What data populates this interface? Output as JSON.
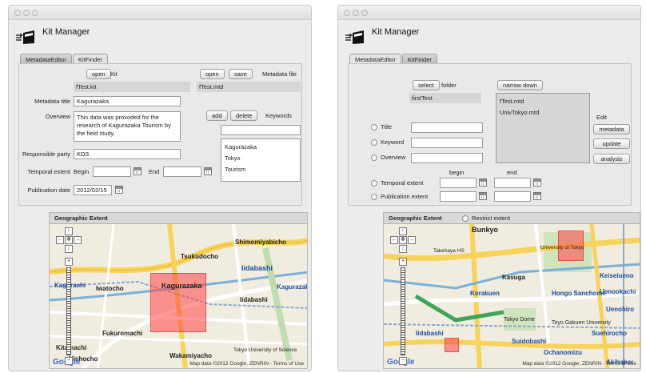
{
  "app_title": "Kit Manager",
  "tabs": {
    "metadata_editor": "MetadataEditor",
    "kit_finder": "KitFinder"
  },
  "editor": {
    "open_kit_label": "open",
    "kit_label": "Kit",
    "kit_file": "fTest.kit",
    "open_meta_label": "open",
    "save_label": "save",
    "metadata_file_label": "Metadata file",
    "metadata_file": "fTest.mtd",
    "metadata_title_label": "Metadata title",
    "metadata_title": "Kagurazaka",
    "overview_label": "Overview",
    "overview": "This data was provoded for the research of Kagurazaka Tourism by the field study.",
    "add_label": "add",
    "delete_label": "delete",
    "keywords_label": "Keywords",
    "keywords_input": "",
    "keywords": [
      "Kagurazaka",
      "Tokyo",
      "Tourism"
    ],
    "responsible_party_label": "Responsible party",
    "responsible_party": "KDS",
    "temporal_extent_label": "Temporal extent",
    "begin_label": "Begin",
    "end_label": "End",
    "begin_value": "",
    "end_value": "",
    "publication_date_label": "Publication date",
    "publication_date": "2012/02/15"
  },
  "finder": {
    "select_label": "select",
    "folder_label": "folder",
    "folder_value": "firstTest",
    "narrow_down_label": "narrow down",
    "results": [
      "fTest.mtd",
      "UnivTokyo.mtd"
    ],
    "title_label": "Title",
    "keyword_label": "Keyword",
    "overview_label": "Overview",
    "edit_label": "Edit",
    "metadata_btn": "metadata",
    "update_btn": "update",
    "analysis_btn": "analysis",
    "begin_label": "begin",
    "end_label": "end",
    "temporal_extent_label": "Temporal extent",
    "publication_extent_label": "Publication extent"
  },
  "map_left": {
    "header": "Geographic Extent",
    "labels": [
      "Shimomiyabicho",
      "Tsukudocho",
      "Iidabashi",
      "Kagurazaka",
      "Iwatocho",
      "Kagurazaka",
      "Iidabashi",
      "Kagurashi",
      "Fukuromachi",
      "Kitamachi",
      "Nishocho",
      "Wakamiyacho",
      "Tokyo University of Science"
    ],
    "attribution": "Map data ©2012 Google, ZENRIN - Terms of Use",
    "google": "Google"
  },
  "map_right": {
    "header": "Geographic Extent",
    "restrict_label": "Restrict extent",
    "labels": [
      "Bunkyo",
      "Takehaya HS",
      "University of Tokyo",
      "Kasuga",
      "Korakuen",
      "Hongo Sanchome",
      "Keiseiueno",
      "Uenookachi",
      "Iidabashi",
      "Tokyo Dome",
      "Toyo Gakuen University",
      "Suidobashi",
      "Suehirocho",
      "Ochanomizu",
      "Akihabar",
      "Uenohiro"
    ],
    "attribution": "Map data ©2012 Google, ZENRIN - Terms of Use",
    "google": "Google"
  }
}
